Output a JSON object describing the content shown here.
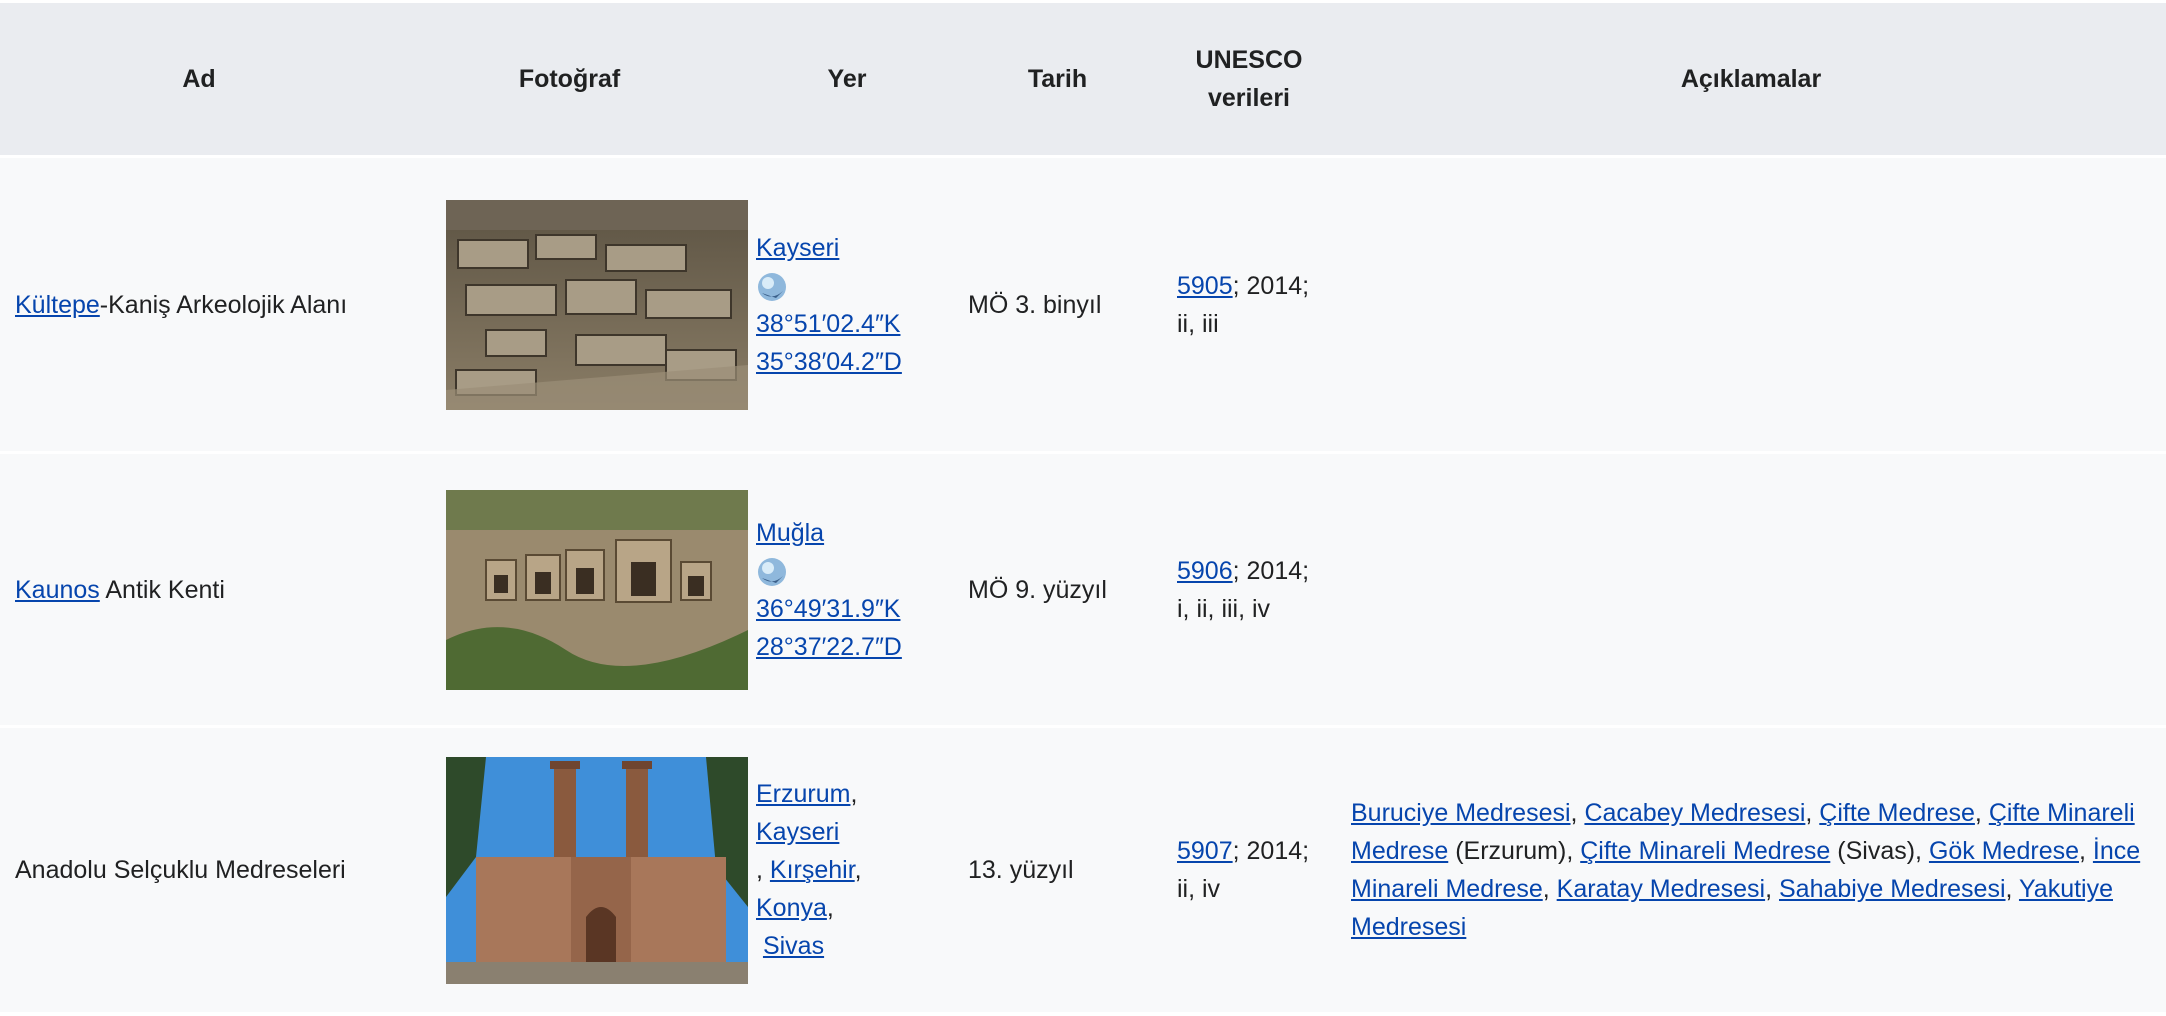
{
  "headers": {
    "ad": "Ad",
    "photo": "Fotoğraf",
    "yer": "Yer",
    "tarih": "Tarih",
    "unesco": "UNESCO verileri",
    "desc": "Açıklamalar"
  },
  "rows": [
    {
      "name_link": "Kültepe",
      "name_rest": "-Kaniş Arkeolojik Alanı",
      "photo_icon": "archaeological-ruins-photo",
      "place": "Kayseri",
      "coords": "38°51′02.4″K 35°38′04.2″D",
      "date": "MÖ 3. binyıl",
      "unesco_id": "5905",
      "unesco_rest": "; 2014; ii, iii"
    },
    {
      "name_link": "Kaunos",
      "name_rest": " Antik Kenti",
      "photo_icon": "rock-tombs-photo",
      "place": "Muğla",
      "coords": "36°49′31.9″K 28°37′22.7″D",
      "date": "MÖ 9. yüzyıl",
      "unesco_id": "5906",
      "unesco_rest": "; 2014; i, ii, iii, iv"
    },
    {
      "name": "Anadolu Selçuklu Medreseleri",
      "photo_icon": "twin-minaret-madrasa-photo",
      "places": [
        "Erzurum",
        "Kayseri",
        "Kırşehir",
        "Konya",
        "Sivas"
      ],
      "date": "13. yüzyıl",
      "unesco_id": "5907",
      "unesco_rest": "; 2014; ii, iv",
      "desc": {
        "l1": "Buruciye Medresesi",
        "l2": "Cacabey Medresesi",
        "l3": "Çifte Medrese",
        "l4": "Çifte Minareli Medrese",
        "t4": " (Erzurum), ",
        "l5": "Çifte Minareli Medrese",
        "t5": " (Sivas), ",
        "l6": "Gök Medrese",
        "l7": "İnce Minareli Medrese",
        "l8": "Karatay Medresesi",
        "l9": "Sahabiye Medresesi",
        "l10": "Yakutiye Medresesi"
      }
    }
  ]
}
